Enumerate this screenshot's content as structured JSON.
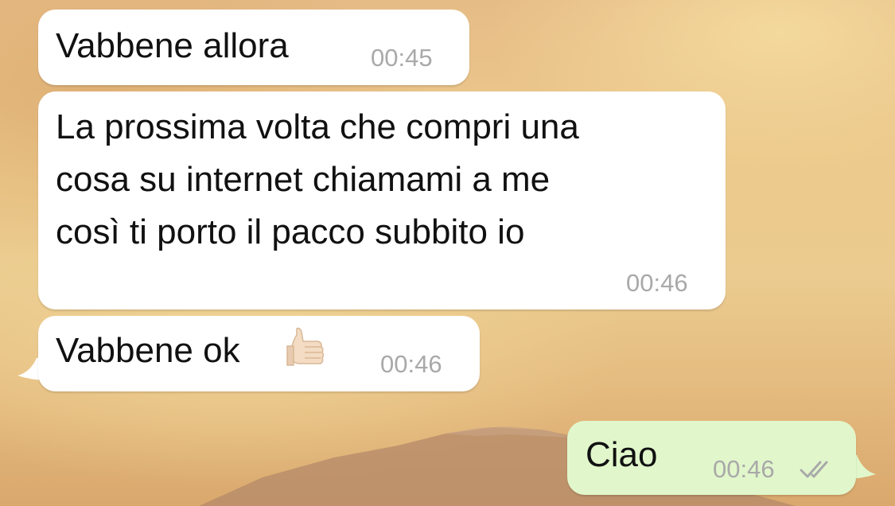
{
  "messages": [
    {
      "direction": "incoming",
      "text": "Vabbene allora",
      "time": "00:45"
    },
    {
      "direction": "incoming",
      "lines": [
        "La prossima volta che compri una",
        "cosa su internet chiamami a me",
        "così ti porto il pacco subbito io"
      ],
      "time": "00:46"
    },
    {
      "direction": "incoming",
      "text": "Vabbene ok",
      "emoji": "thumbs-up-icon",
      "time": "00:46"
    },
    {
      "direction": "outgoing",
      "text": "Ciao",
      "time": "00:46",
      "status_icon": "double-check-icon"
    }
  ],
  "colors": {
    "incoming_bubble": "#ffffff",
    "outgoing_bubble": "#e1f7cb",
    "timestamp": "#a9a9a9",
    "read_ticks": "#a9a9a9"
  }
}
